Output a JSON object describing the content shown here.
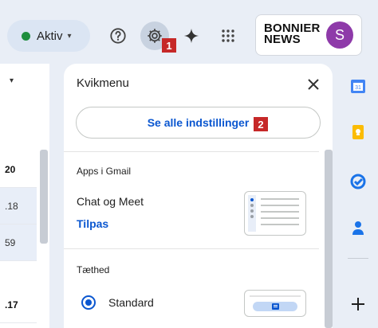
{
  "header": {
    "status_label": "Aktiv",
    "brand_line1": "BONNIER",
    "brand_line2": "NEWS",
    "avatar_letter": "S"
  },
  "annotations": {
    "badge1": "1",
    "badge2": "2"
  },
  "left_list": {
    "rows": [
      {
        "text": "20",
        "bold": true
      },
      {
        "text": ".18",
        "bold": false
      },
      {
        "text": "59",
        "bold": false
      },
      {
        "text": ".17",
        "bold": true
      }
    ]
  },
  "quick_menu": {
    "title": "Kvikmenu",
    "see_all_label": "Se alle indstillinger",
    "apps_section_title": "Apps i Gmail",
    "chat_meet_label": "Chat og Meet",
    "customize_label": "Tilpas",
    "density_section_title": "Tæthed",
    "density_option_label": "Standard"
  },
  "icons": {
    "help": "help-icon",
    "settings": "gear-icon",
    "gemini": "sparkle-icon",
    "apps": "apps-grid-icon",
    "close": "close-icon",
    "rail": [
      "calendar-icon",
      "keep-icon",
      "tasks-icon",
      "contacts-icon",
      "add-icon"
    ]
  },
  "colors": {
    "accent": "#0b57d0",
    "badge": "#c62828",
    "active": "#1e8e3e",
    "avatar": "#8e3aa9"
  }
}
